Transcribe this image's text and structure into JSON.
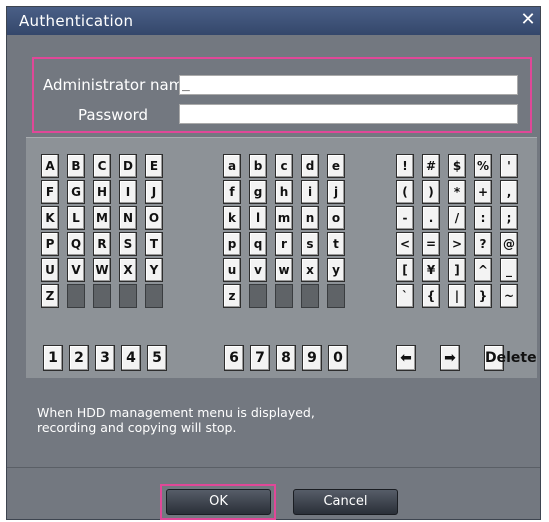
{
  "dialog": {
    "title": "Authentication",
    "close_glyph": "✕",
    "administrator_label": "Administrator name",
    "administrator_value": "_",
    "password_label": "Password",
    "password_value": ""
  },
  "keypad": {
    "uppercase": [
      "A",
      "B",
      "C",
      "D",
      "E",
      "F",
      "G",
      "H",
      "I",
      "J",
      "K",
      "L",
      "M",
      "N",
      "O",
      "P",
      "Q",
      "R",
      "S",
      "T",
      "U",
      "V",
      "W",
      "X",
      "Y",
      "Z"
    ],
    "lowercase": [
      "a",
      "b",
      "c",
      "d",
      "e",
      "f",
      "g",
      "h",
      "i",
      "j",
      "k",
      "l",
      "m",
      "n",
      "o",
      "p",
      "q",
      "r",
      "s",
      "t",
      "u",
      "v",
      "w",
      "x",
      "y",
      "z"
    ],
    "symbols": [
      "!",
      "#",
      "$",
      "%",
      "'",
      "(",
      ")",
      "*",
      "+",
      ",",
      "-",
      ".",
      "/",
      ":",
      ";",
      "<",
      "=",
      ">",
      "?",
      "@",
      "[",
      "¥",
      "]",
      "^",
      "_",
      "`",
      "{",
      "|",
      "}",
      "~"
    ],
    "digits_left": [
      "1",
      "2",
      "3",
      "4",
      "5"
    ],
    "digits_right": [
      "6",
      "7",
      "8",
      "9",
      "0"
    ],
    "left_arrow": "⬅",
    "right_arrow": "➡",
    "delete_label": "Delete"
  },
  "note": {
    "line1": "When HDD management menu is displayed,",
    "line2": "recording and copying will stop."
  },
  "buttons": {
    "ok": "OK",
    "cancel": "Cancel"
  },
  "colors": {
    "dialog_bg": "#737880",
    "titlebar": "#34476b",
    "highlight": "#e04898",
    "keypad_bg": "#8d9297"
  }
}
